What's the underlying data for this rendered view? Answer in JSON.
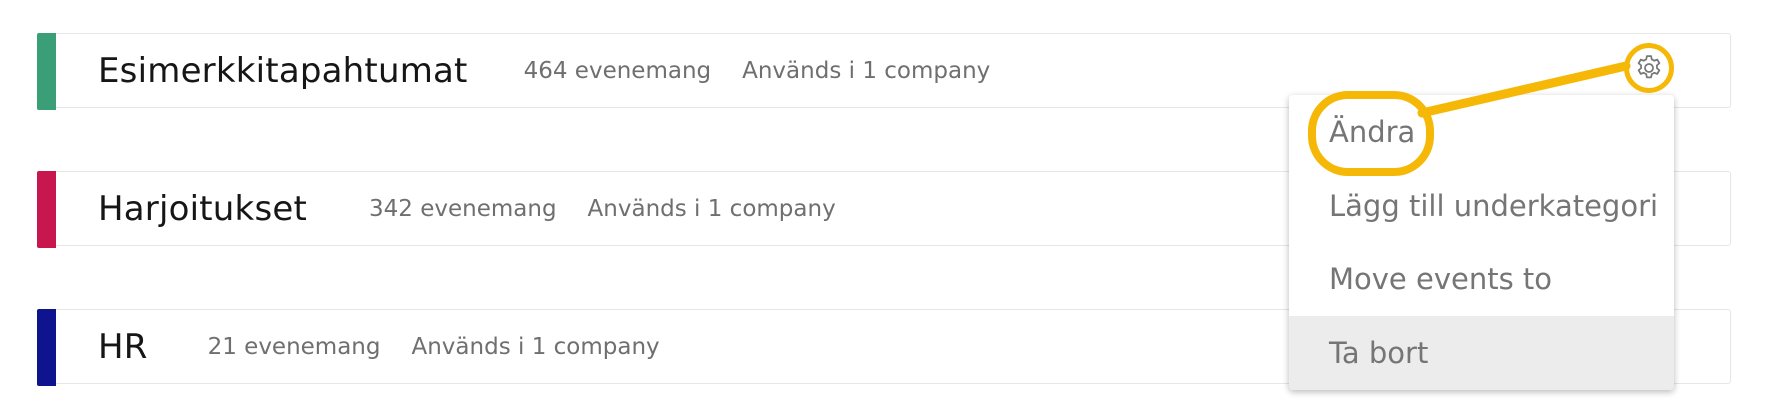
{
  "categories": [
    {
      "title": "Esimerkkitapahtumat",
      "event_count": "464 evenemang",
      "usage": "Används i 1 company",
      "color": "#3a9e77"
    },
    {
      "title": "Harjoitukset",
      "event_count": "342 evenemang",
      "usage": "Används i 1 company",
      "color": "#c8164f"
    },
    {
      "title": "HR",
      "event_count": "21 evenemang",
      "usage": "Används i 1 company",
      "color": "#0d148e"
    }
  ],
  "settings_menu": {
    "icon": "gear-icon",
    "items": [
      {
        "label": "Ändra"
      },
      {
        "label": "Lägg till underkategori"
      },
      {
        "label": "Move events to"
      },
      {
        "label": "Ta bort"
      }
    ]
  },
  "colors": {
    "annotation": "#f6b807",
    "menu_highlight": "#ececec",
    "secondary_text": "#6f6f6f"
  }
}
